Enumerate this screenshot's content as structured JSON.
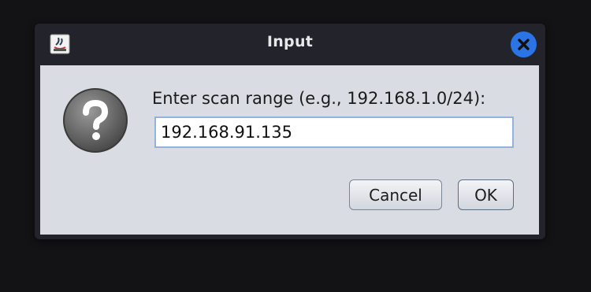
{
  "window": {
    "title": "Input",
    "close_icon": "close-icon",
    "app_icon": "java-app-icon",
    "accent_color": "#2a74e6"
  },
  "dialog": {
    "icon": "question-icon",
    "prompt": "Enter scan range (e.g., 192.168.1.0/24):",
    "input_value": "192.168.91.135"
  },
  "buttons": {
    "cancel_label": "Cancel",
    "ok_label": "OK"
  }
}
